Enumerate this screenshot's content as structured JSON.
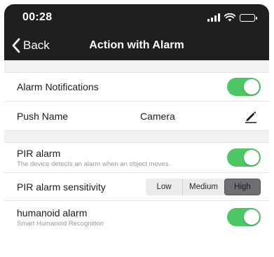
{
  "status_bar": {
    "time": "00:28",
    "signal_icon": "signal-bars-icon",
    "wifi_icon": "wifi-icon",
    "battery_icon": "battery-icon",
    "battery_level": 0.4
  },
  "nav": {
    "back_label": "Back",
    "title": "Action with Alarm"
  },
  "settings": {
    "alarm_notifications": {
      "label": "Alarm Notifications",
      "enabled": true
    },
    "push_name": {
      "label": "Push Name",
      "value": "Camera"
    },
    "pir_alarm": {
      "label": "PIR alarm",
      "description": "The device detects an alarm when an object moves.",
      "enabled": true
    },
    "pir_sensitivity": {
      "label": "PIR alarm sensitivity",
      "options": [
        "Low",
        "Medium",
        "High"
      ],
      "selected": "High"
    },
    "humanoid_alarm": {
      "label": "humanoid alarm",
      "description": "Smart Humanoid Recognition",
      "enabled": true
    }
  },
  "colors": {
    "toggle_on": "#4cc764",
    "nav_background": "#1f1f1f",
    "segment_selected": "#6f6f73"
  }
}
